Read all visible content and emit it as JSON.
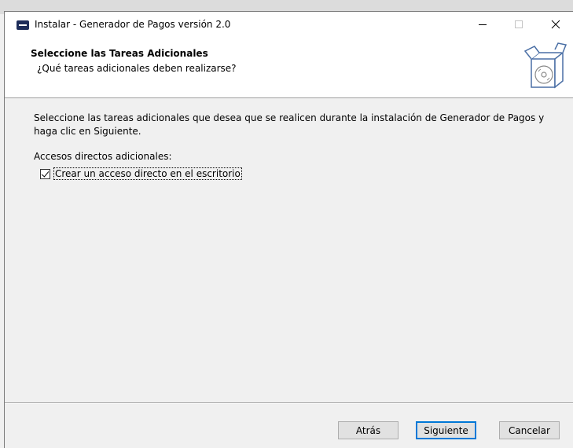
{
  "window": {
    "title": "Instalar - Generador de Pagos versión 2.0"
  },
  "header": {
    "title": "Seleccione las Tareas Adicionales",
    "subtitle": "¿Qué tareas adicionales deben realizarse?"
  },
  "body": {
    "description": "Seleccione las tareas adicionales que desea que se realicen durante la instalación de Generador de Pagos y haga clic en Siguiente.",
    "group_label": "Accesos directos adicionales:",
    "tasks": [
      {
        "label": "Crear un acceso directo en el escritorio",
        "checked": true
      }
    ]
  },
  "buttons": {
    "back": "Atrás",
    "next": "Siguiente",
    "cancel": "Cancelar"
  },
  "icons": {
    "app": "installer-app-icon",
    "header": "software-box-cd-icon"
  }
}
